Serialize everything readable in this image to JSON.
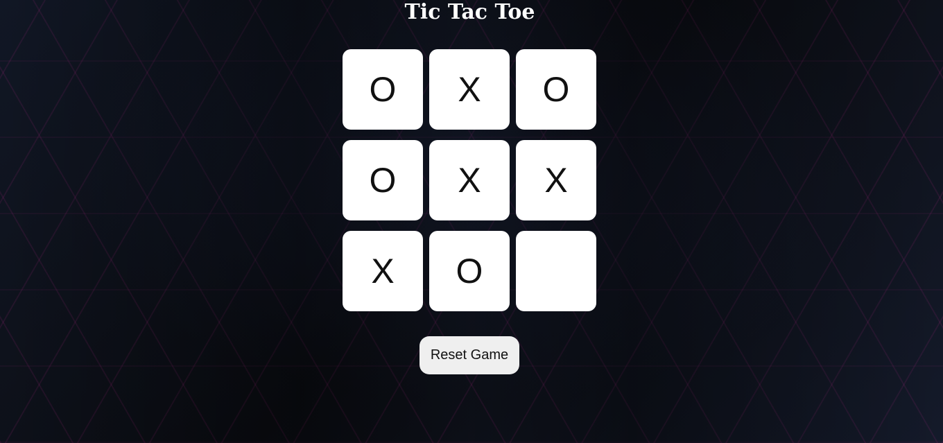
{
  "title": "Tic Tac Toe",
  "board": {
    "cells": [
      "O",
      "X",
      "O",
      "O",
      "X",
      "X",
      "X",
      "O",
      ""
    ]
  },
  "reset_button": {
    "label": "Reset Game"
  },
  "colors": {
    "background": "#0d0f16",
    "accent_lines": "#dc28a0",
    "cell": "#ffffff",
    "button": "#efefef",
    "title_text": "#ffffff"
  }
}
